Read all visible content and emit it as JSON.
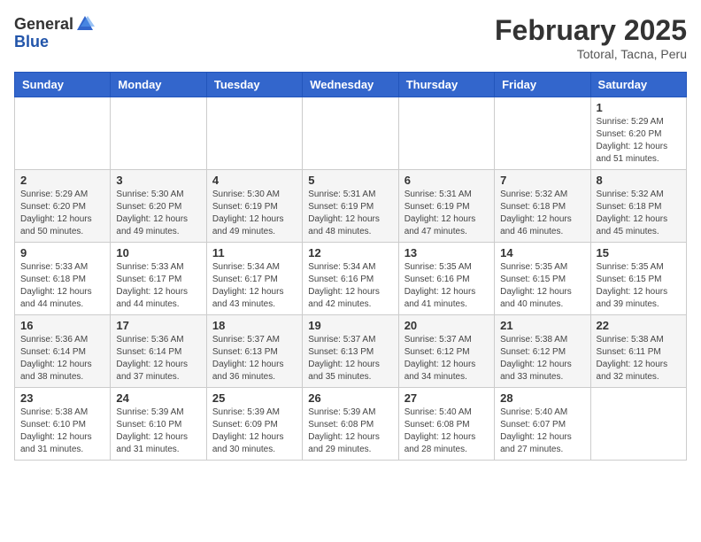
{
  "logo": {
    "general": "General",
    "blue": "Blue"
  },
  "title": "February 2025",
  "location": "Totoral, Tacna, Peru",
  "weekdays": [
    "Sunday",
    "Monday",
    "Tuesday",
    "Wednesday",
    "Thursday",
    "Friday",
    "Saturday"
  ],
  "weeks": [
    [
      {
        "day": "",
        "info": ""
      },
      {
        "day": "",
        "info": ""
      },
      {
        "day": "",
        "info": ""
      },
      {
        "day": "",
        "info": ""
      },
      {
        "day": "",
        "info": ""
      },
      {
        "day": "",
        "info": ""
      },
      {
        "day": "1",
        "info": "Sunrise: 5:29 AM\nSunset: 6:20 PM\nDaylight: 12 hours\nand 51 minutes."
      }
    ],
    [
      {
        "day": "2",
        "info": "Sunrise: 5:29 AM\nSunset: 6:20 PM\nDaylight: 12 hours\nand 50 minutes."
      },
      {
        "day": "3",
        "info": "Sunrise: 5:30 AM\nSunset: 6:20 PM\nDaylight: 12 hours\nand 49 minutes."
      },
      {
        "day": "4",
        "info": "Sunrise: 5:30 AM\nSunset: 6:19 PM\nDaylight: 12 hours\nand 49 minutes."
      },
      {
        "day": "5",
        "info": "Sunrise: 5:31 AM\nSunset: 6:19 PM\nDaylight: 12 hours\nand 48 minutes."
      },
      {
        "day": "6",
        "info": "Sunrise: 5:31 AM\nSunset: 6:19 PM\nDaylight: 12 hours\nand 47 minutes."
      },
      {
        "day": "7",
        "info": "Sunrise: 5:32 AM\nSunset: 6:18 PM\nDaylight: 12 hours\nand 46 minutes."
      },
      {
        "day": "8",
        "info": "Sunrise: 5:32 AM\nSunset: 6:18 PM\nDaylight: 12 hours\nand 45 minutes."
      }
    ],
    [
      {
        "day": "9",
        "info": "Sunrise: 5:33 AM\nSunset: 6:18 PM\nDaylight: 12 hours\nand 44 minutes."
      },
      {
        "day": "10",
        "info": "Sunrise: 5:33 AM\nSunset: 6:17 PM\nDaylight: 12 hours\nand 44 minutes."
      },
      {
        "day": "11",
        "info": "Sunrise: 5:34 AM\nSunset: 6:17 PM\nDaylight: 12 hours\nand 43 minutes."
      },
      {
        "day": "12",
        "info": "Sunrise: 5:34 AM\nSunset: 6:16 PM\nDaylight: 12 hours\nand 42 minutes."
      },
      {
        "day": "13",
        "info": "Sunrise: 5:35 AM\nSunset: 6:16 PM\nDaylight: 12 hours\nand 41 minutes."
      },
      {
        "day": "14",
        "info": "Sunrise: 5:35 AM\nSunset: 6:15 PM\nDaylight: 12 hours\nand 40 minutes."
      },
      {
        "day": "15",
        "info": "Sunrise: 5:35 AM\nSunset: 6:15 PM\nDaylight: 12 hours\nand 39 minutes."
      }
    ],
    [
      {
        "day": "16",
        "info": "Sunrise: 5:36 AM\nSunset: 6:14 PM\nDaylight: 12 hours\nand 38 minutes."
      },
      {
        "day": "17",
        "info": "Sunrise: 5:36 AM\nSunset: 6:14 PM\nDaylight: 12 hours\nand 37 minutes."
      },
      {
        "day": "18",
        "info": "Sunrise: 5:37 AM\nSunset: 6:13 PM\nDaylight: 12 hours\nand 36 minutes."
      },
      {
        "day": "19",
        "info": "Sunrise: 5:37 AM\nSunset: 6:13 PM\nDaylight: 12 hours\nand 35 minutes."
      },
      {
        "day": "20",
        "info": "Sunrise: 5:37 AM\nSunset: 6:12 PM\nDaylight: 12 hours\nand 34 minutes."
      },
      {
        "day": "21",
        "info": "Sunrise: 5:38 AM\nSunset: 6:12 PM\nDaylight: 12 hours\nand 33 minutes."
      },
      {
        "day": "22",
        "info": "Sunrise: 5:38 AM\nSunset: 6:11 PM\nDaylight: 12 hours\nand 32 minutes."
      }
    ],
    [
      {
        "day": "23",
        "info": "Sunrise: 5:38 AM\nSunset: 6:10 PM\nDaylight: 12 hours\nand 31 minutes."
      },
      {
        "day": "24",
        "info": "Sunrise: 5:39 AM\nSunset: 6:10 PM\nDaylight: 12 hours\nand 31 minutes."
      },
      {
        "day": "25",
        "info": "Sunrise: 5:39 AM\nSunset: 6:09 PM\nDaylight: 12 hours\nand 30 minutes."
      },
      {
        "day": "26",
        "info": "Sunrise: 5:39 AM\nSunset: 6:08 PM\nDaylight: 12 hours\nand 29 minutes."
      },
      {
        "day": "27",
        "info": "Sunrise: 5:40 AM\nSunset: 6:08 PM\nDaylight: 12 hours\nand 28 minutes."
      },
      {
        "day": "28",
        "info": "Sunrise: 5:40 AM\nSunset: 6:07 PM\nDaylight: 12 hours\nand 27 minutes."
      },
      {
        "day": "",
        "info": ""
      }
    ]
  ]
}
